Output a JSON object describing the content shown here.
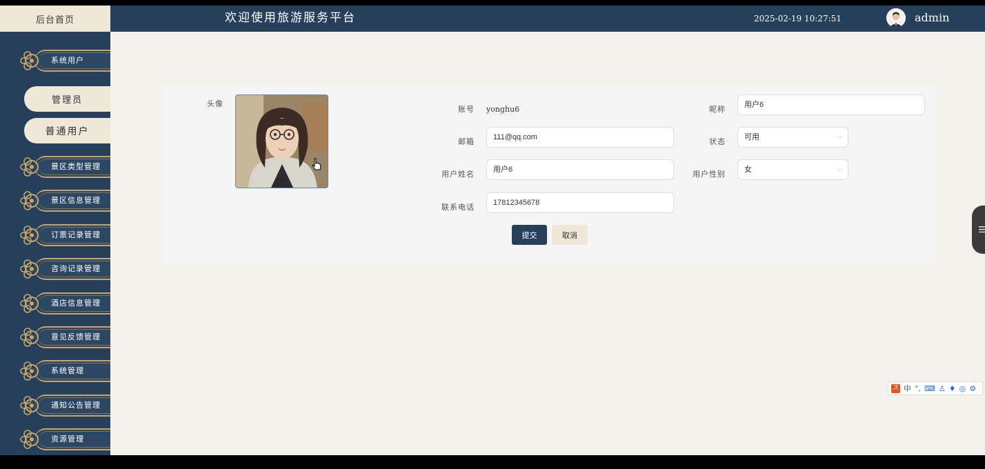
{
  "topbar": {
    "home_label": "后台首页",
    "site_title": "欢迎使用旅游服务平台",
    "datetime": "2025-02-19 10:27:51",
    "username": "admin"
  },
  "sidebar": {
    "items": [
      {
        "label": "系统用户"
      },
      {
        "label": "景区类型管理"
      },
      {
        "label": "景区信息管理"
      },
      {
        "label": "订票记录管理"
      },
      {
        "label": "咨询记录管理"
      },
      {
        "label": "酒店信息管理"
      },
      {
        "label": "意见反馈管理"
      },
      {
        "label": "系统管理"
      },
      {
        "label": "通知公告管理"
      },
      {
        "label": "资源管理"
      }
    ],
    "sub_items": [
      {
        "label": "管理员"
      },
      {
        "label": "普通用户"
      }
    ]
  },
  "form": {
    "avatar_label": "头像",
    "account_label": "账号",
    "account_value": "yonghu6",
    "nickname_label": "昵称",
    "nickname_value": "用户6",
    "email_label": "邮箱",
    "email_value": "111@qq.com",
    "status_label": "状态",
    "status_value": "可用",
    "realname_label": "用户姓名",
    "realname_value": "用户6",
    "gender_label": "用户性别",
    "gender_value": "女",
    "phone_label": "联系电话",
    "phone_value": "17812345678",
    "submit_label": "提交",
    "cancel_label": "取消"
  },
  "ime": {
    "mode": "中"
  },
  "colors": {
    "navy": "#263f5a",
    "cream": "#efe7d8",
    "gold": "#c9a76a",
    "background": "#f4f2ec"
  }
}
